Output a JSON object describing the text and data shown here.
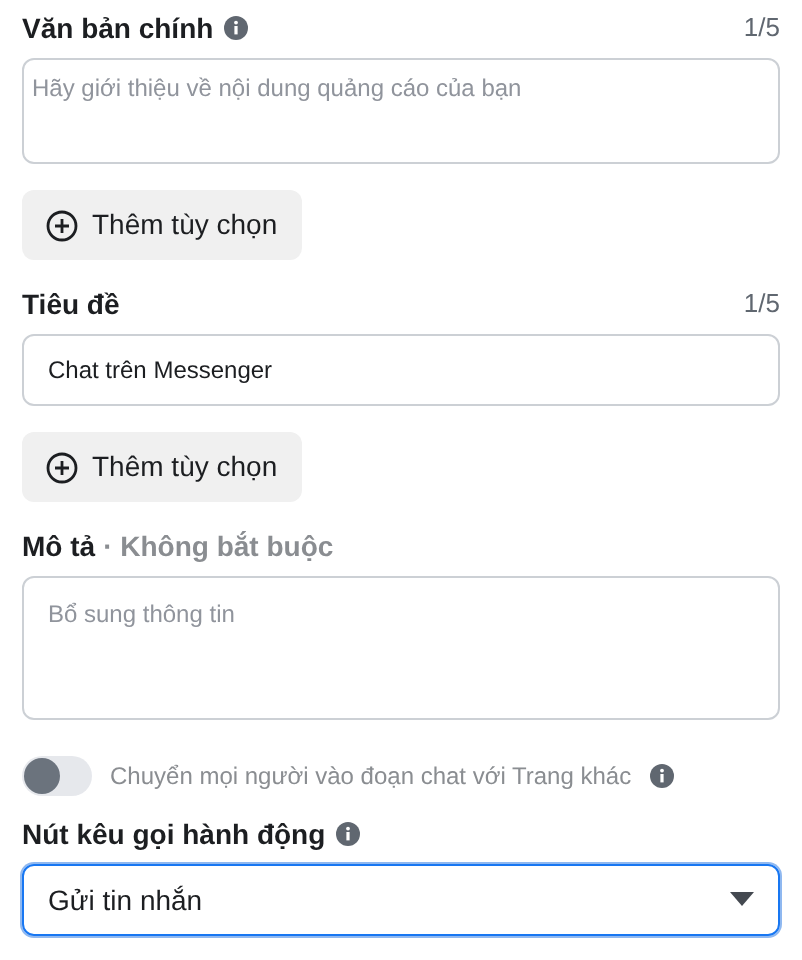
{
  "fields": [
    {
      "kind": "textarea",
      "label": "Văn bản chính",
      "info": true,
      "counter": "1/5",
      "placeholder": "Hãy giới thiệu về nội dung quảng cáo của bạn",
      "add_button": "Thêm tùy chọn"
    },
    {
      "kind": "input",
      "label": "Tiêu đề",
      "info": false,
      "counter": "1/5",
      "value": "Chat trên Messenger",
      "add_button": "Thêm tùy chọn"
    },
    {
      "kind": "textarea_tall",
      "label": "Mô tả",
      "optional": "· Không bắt buộc",
      "info": false,
      "placeholder": "Bổ sung thông tin"
    }
  ],
  "toggle": {
    "label": "Chuyển mọi người vào đoạn chat với Trang khác",
    "on": false,
    "disabled": true,
    "info": true
  },
  "call_to_action": {
    "label": "Nút kêu gọi hành động",
    "info": true,
    "value": "Gửi tin nhắn",
    "focused": true
  }
}
